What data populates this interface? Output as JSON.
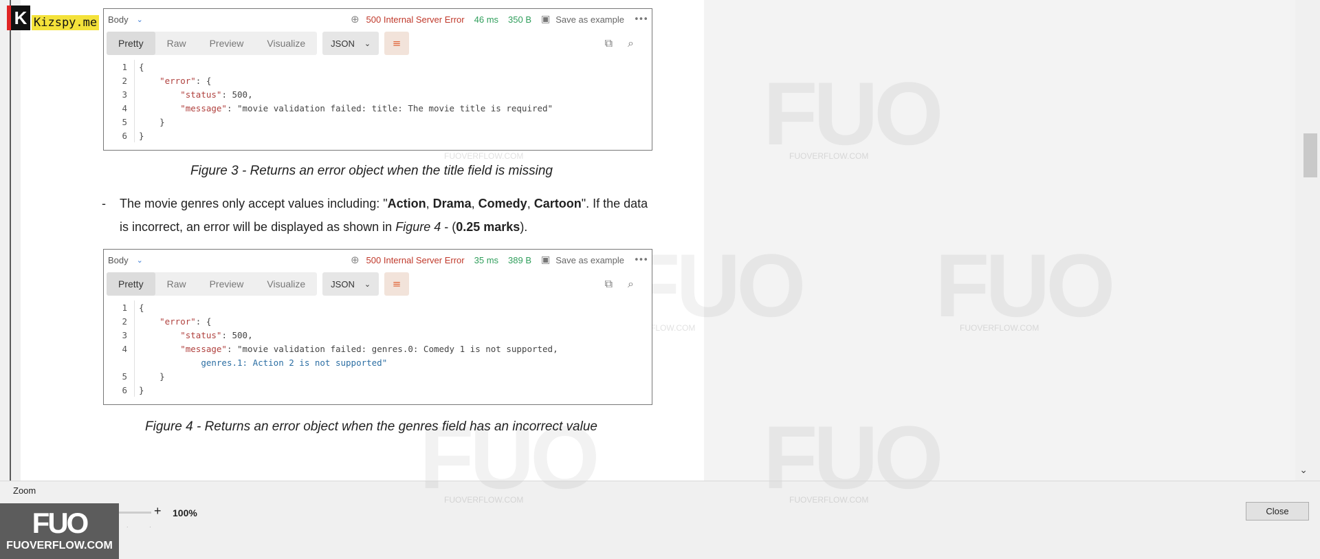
{
  "logo": {
    "letter": "K",
    "text": "Kizspy.me"
  },
  "response1": {
    "body_label": "Body",
    "status": "500 Internal Server Error",
    "time": "46 ms",
    "size": "350 B",
    "save_label": "Save as example",
    "tabs": [
      "Pretty",
      "Raw",
      "Preview",
      "Visualize"
    ],
    "format": "JSON",
    "lines": [
      {
        "n": "1",
        "t": "{"
      },
      {
        "n": "2",
        "t": "    \"error\": {"
      },
      {
        "n": "3",
        "t": "        \"status\": 500,"
      },
      {
        "n": "4",
        "t": "        \"message\": \"movie validation failed: title: The movie title is required\""
      },
      {
        "n": "5",
        "t": "    }"
      },
      {
        "n": "6",
        "t": "}"
      }
    ]
  },
  "caption1": "Figure 3 - Returns an error object when the title field is missing",
  "paragraph": {
    "dash": "-",
    "text1": "The movie genres only accept values including: \"",
    "g1": "Action",
    "sep1": ", ",
    "g2": "Drama",
    "sep2": ", ",
    "g3": "Comedy",
    "sep3": ", ",
    "g4": "Cartoon",
    "text2": "\". If the data is incorrect, an error will be displayed as shown in ",
    "fig": "Figure 4",
    "text3": " - (",
    "marks": "0.25 marks",
    "text4": ")."
  },
  "response2": {
    "body_label": "Body",
    "status": "500 Internal Server Error",
    "time": "35 ms",
    "size": "389 B",
    "save_label": "Save as example",
    "tabs": [
      "Pretty",
      "Raw",
      "Preview",
      "Visualize"
    ],
    "format": "JSON",
    "lines": [
      {
        "n": "1",
        "t": "{"
      },
      {
        "n": "2",
        "t": "    \"error\": {"
      },
      {
        "n": "3",
        "t": "        \"status\": 500,"
      },
      {
        "n": "4",
        "t": "        \"message\": \"movie validation failed: genres.0: Comedy 1 is not supported,"
      },
      {
        "n": "",
        "t": "            genres.1: Action 2 is not supported\""
      },
      {
        "n": "5",
        "t": "    }"
      },
      {
        "n": "6",
        "t": "}"
      }
    ]
  },
  "caption2": "Figure 4 - Returns an error object when the genres field has an incorrect value",
  "zoom": {
    "label": "Zoom",
    "minus": "-",
    "plus": "+",
    "value": "100%"
  },
  "close_label": "Close",
  "watermark": {
    "mark": "FUO",
    "text": "FUOVERFLOW.COM"
  }
}
